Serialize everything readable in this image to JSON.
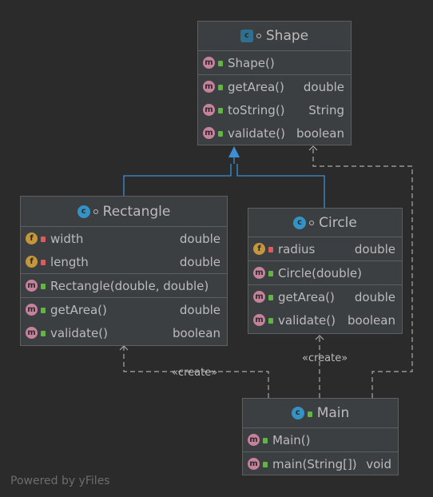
{
  "diagram": {
    "shape": {
      "title": "Shape",
      "constructors": [
        {
          "name": "Shape()",
          "type": ""
        }
      ],
      "methods": [
        {
          "name": "getArea()",
          "type": "double"
        },
        {
          "name": "toString()",
          "type": "String"
        },
        {
          "name": "validate()",
          "type": "boolean"
        }
      ]
    },
    "rectangle": {
      "title": "Rectangle",
      "fields": [
        {
          "name": "width",
          "type": "double"
        },
        {
          "name": "length",
          "type": "double"
        }
      ],
      "constructors": [
        {
          "name": "Rectangle(double, double)",
          "type": ""
        }
      ],
      "methods": [
        {
          "name": "getArea()",
          "type": "double"
        },
        {
          "name": "validate()",
          "type": "boolean"
        }
      ]
    },
    "circle": {
      "title": "Circle",
      "fields": [
        {
          "name": "radius",
          "type": "double"
        }
      ],
      "constructors": [
        {
          "name": "Circle(double)",
          "type": ""
        }
      ],
      "methods": [
        {
          "name": "getArea()",
          "type": "double"
        },
        {
          "name": "validate()",
          "type": "boolean"
        }
      ]
    },
    "main": {
      "title": "Main",
      "constructors": [
        {
          "name": "Main()",
          "type": ""
        }
      ],
      "methods": [
        {
          "name": "main(String[])",
          "type": "void"
        }
      ]
    },
    "edge_labels": {
      "create_rectangle": "«create»",
      "create_circle": "«create»"
    },
    "icons": {
      "class": "c",
      "method": "m",
      "field": "f"
    },
    "watermark": "Powered by yFiles"
  },
  "colors": {
    "background": "#2b2b2b",
    "node": "#3c3f41",
    "border": "#5e6060",
    "inheritance": "#3d8fd5",
    "dependency": "#a9a9a9"
  }
}
